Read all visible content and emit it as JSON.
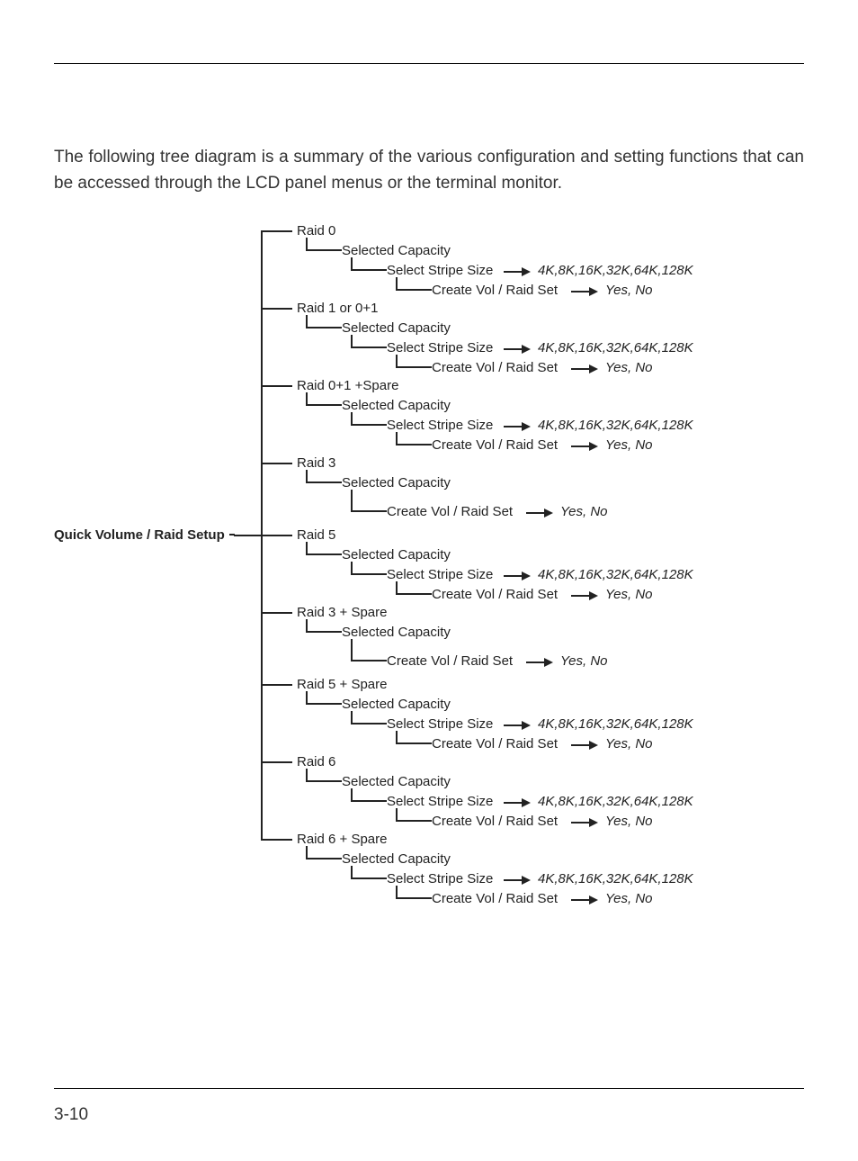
{
  "intro": "The following tree diagram is a summary of the various configuration and setting functions that can be accessed through the LCD panel menus or the terminal monitor.",
  "root": "Quick Volume / Raid Setup",
  "branches": [
    {
      "name": "Raid 0",
      "hasStripe": true
    },
    {
      "name": "Raid 1 or 0+1",
      "hasStripe": true
    },
    {
      "name": "Raid 0+1 +Spare",
      "hasStripe": true
    },
    {
      "name": "Raid 3",
      "hasStripe": false
    },
    {
      "name": "Raid 5",
      "hasStripe": true
    },
    {
      "name": "Raid 3 + Spare",
      "hasStripe": false
    },
    {
      "name": "Raid 5 + Spare",
      "hasStripe": true
    },
    {
      "name": "Raid 6",
      "hasStripe": true
    },
    {
      "name": "Raid 6 + Spare",
      "hasStripe": true
    }
  ],
  "labels": {
    "selectedCapacity": "Selected Capacity",
    "selectStripe": "Select Stripe Size",
    "stripeOptions": "4K,8K,16K,32K,64K,128K",
    "createVol": "Create Vol / Raid Set",
    "yesNo": "Yes, No"
  },
  "pageNum": "3-10"
}
